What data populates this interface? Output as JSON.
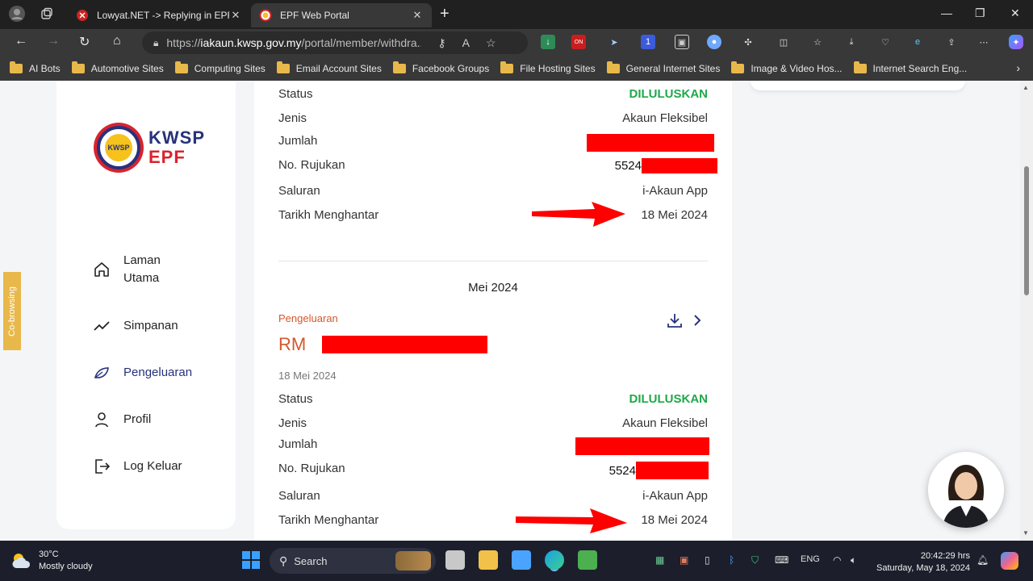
{
  "browser": {
    "tabs": [
      {
        "title": "Lowyat.NET -> Replying in EPF A",
        "icon": "lowyat-icon",
        "active": false
      },
      {
        "title": "EPF Web Portal",
        "icon": "kwsp-favicon",
        "active": true
      }
    ],
    "url_prefix": "https://",
    "url_host": "iakaun.kwsp.gov.my",
    "url_path": "/portal/member/withdra...",
    "bookmarks": [
      "AI Bots",
      "Automotive Sites",
      "Computing Sites",
      "Email Account Sites",
      "Facebook Groups",
      "File Hosting Sites",
      "General Internet Sites",
      "Image & Video Hos...",
      "Internet Search Eng..."
    ],
    "extension_badge": "ON",
    "extension_count": "1"
  },
  "sidebar": {
    "logo_line1": "KWSP",
    "logo_line2": "EPF",
    "logo_seal": "KWSP",
    "items": [
      {
        "label": "Laman Utama",
        "icon": "home-icon",
        "active": false
      },
      {
        "label": "Simpanan",
        "icon": "trend-line-icon",
        "active": false
      },
      {
        "label": "Pengeluaran",
        "icon": "withdrawal-leaf-icon",
        "active": true
      },
      {
        "label": "Profil",
        "icon": "user-icon",
        "active": false
      },
      {
        "label": "Log Keluar",
        "icon": "logout-icon",
        "active": false
      }
    ]
  },
  "cobrowse_label": "Co-browsing",
  "record1": {
    "status_label": "Status",
    "status_value": "DILULUSKAN",
    "jenis_label": "Jenis",
    "jenis_value": "Akaun Fleksibel",
    "jumlah_label": "Jumlah",
    "rujukan_label": "No. Rujukan",
    "rujukan_value": "5524",
    "saluran_label": "Saluran",
    "saluran_value": "i-Akaun App",
    "tarikh_label": "Tarikh Menghantar",
    "tarikh_value": "18 Mei 2024"
  },
  "month_header": "Mei 2024",
  "record2": {
    "category": "Pengeluaran",
    "currency": "RM",
    "date": "18 Mei 2024",
    "status_label": "Status",
    "status_value": "DILULUSKAN",
    "jenis_label": "Jenis",
    "jenis_value": "Akaun Fleksibel",
    "jumlah_label": "Jumlah",
    "rujukan_label": "No. Rujukan",
    "rujukan_value": "5524",
    "saluran_label": "Saluran",
    "saluran_value": "i-Akaun App",
    "tarikh_label": "Tarikh Menghantar",
    "tarikh_value": "18 Mei 2024"
  },
  "colors": {
    "status_green": "#1ea84a",
    "accent_orange": "#d4572a",
    "brand_navy": "#27327b",
    "brand_red": "#d9232e",
    "redaction": "#ff0000"
  },
  "taskbar": {
    "temperature": "30°C",
    "weather": "Mostly cloudy",
    "search_placeholder": "Search",
    "language": "ENG",
    "time": "20:42:29 hrs",
    "date": "Saturday, May 18, 2024"
  }
}
